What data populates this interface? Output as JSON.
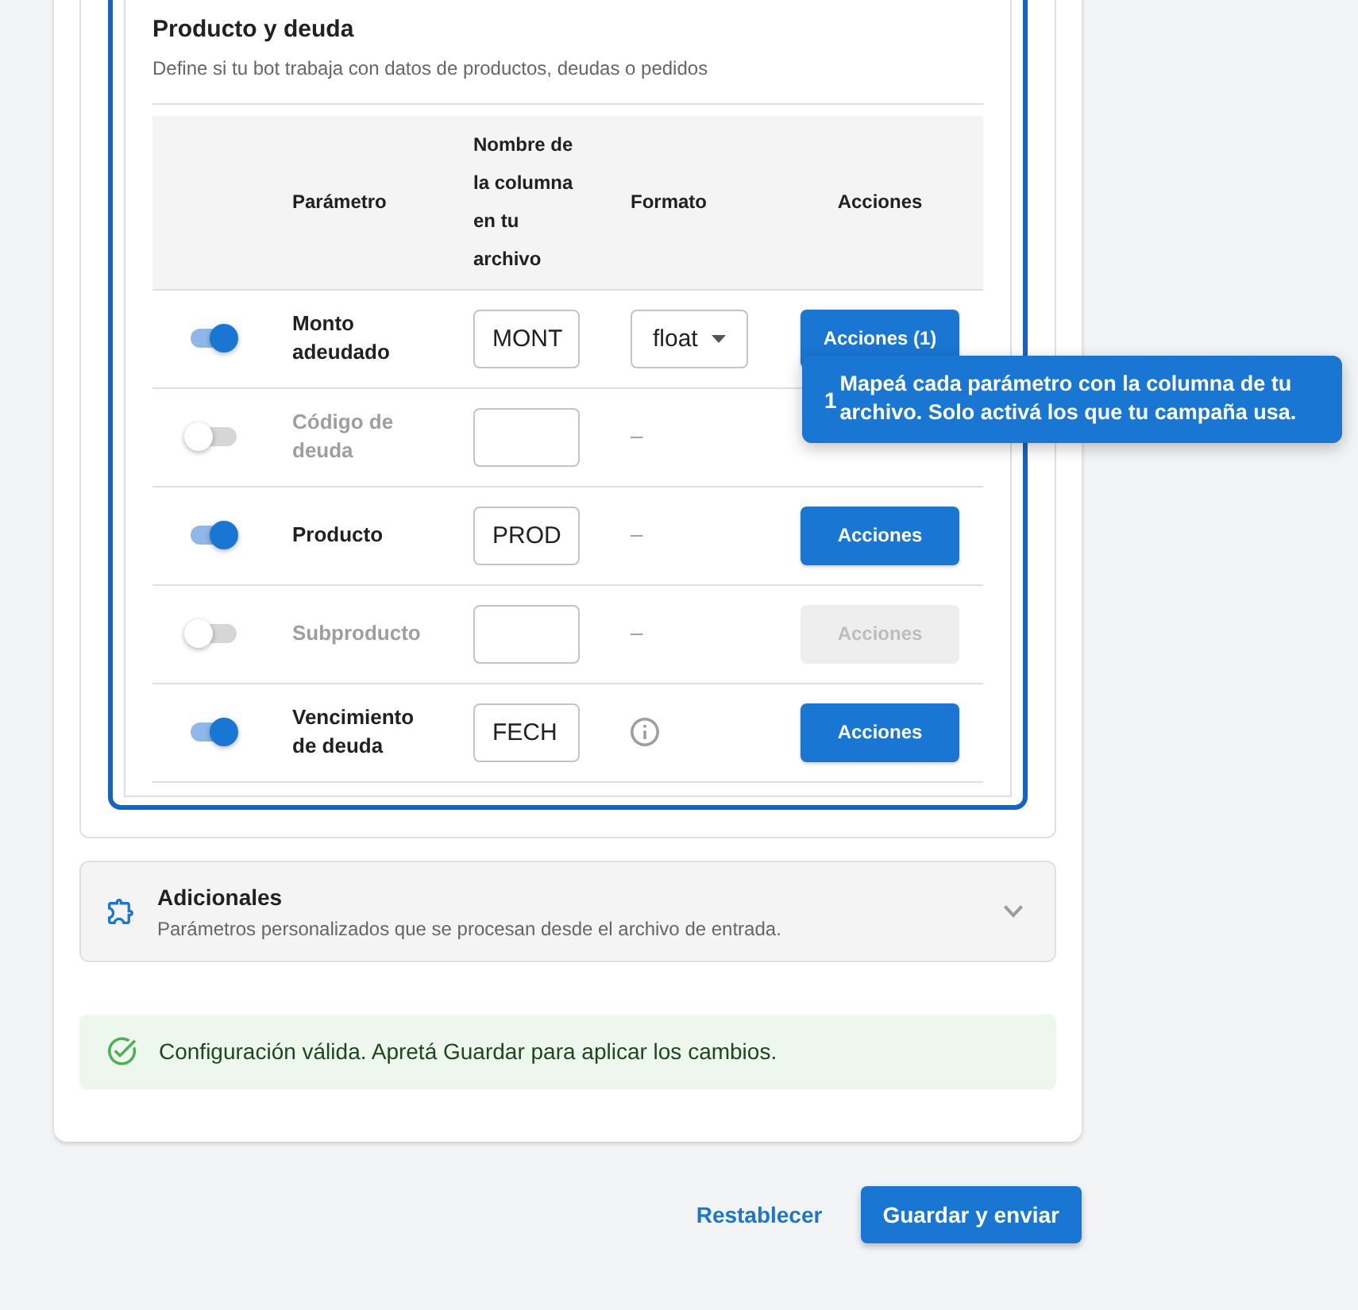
{
  "section": {
    "title": "Producto y deuda",
    "subtitle": "Define si tu bot trabaja con datos de productos, deudas o pedidos",
    "highlighted": true
  },
  "table": {
    "columns": [
      "Parámetro",
      "Nombre de la columna en tu archivo",
      "Formato",
      "Acciones"
    ],
    "rows": [
      {
        "on": true,
        "parameter": "Monto adeudado",
        "column_name": "MONT",
        "format": {
          "kind": "select",
          "value": "float"
        },
        "action": {
          "label": "Acciones (1)",
          "disabled": false
        }
      },
      {
        "on": false,
        "parameter": "Código de deuda",
        "format": {
          "kind": "text",
          "text": "–"
        }
      },
      {
        "on": true,
        "parameter": "Producto",
        "column_name": "PROD",
        "format": {
          "kind": "text",
          "text": "–"
        },
        "action": {
          "label": "Acciones",
          "disabled": false
        }
      },
      {
        "on": false,
        "parameter": "Subproducto",
        "format": {
          "kind": "text",
          "text": "–"
        },
        "action": {
          "label": "Acciones",
          "disabled": true
        }
      },
      {
        "on": true,
        "parameter": "Vencimiento de deuda",
        "column_name": "FECH",
        "format": {
          "kind": "info"
        },
        "action": {
          "label": "Acciones",
          "disabled": false
        }
      }
    ]
  },
  "tooltip": {
    "step": "1",
    "text": "Mapeá cada parámetro con la columna de tu archivo. Solo activá los que tu campaña usa."
  },
  "additional": {
    "title": "Adicionales",
    "subtitle": "Parámetros personalizados que se procesan desde el archivo de entrada.",
    "expanded": false
  },
  "alert": {
    "kind": "success",
    "text": "Configuración válida. Apretá Guardar para aplicar los cambios."
  },
  "footer": {
    "buttons": [
      {
        "label": "Restablecer",
        "kind": "text"
      },
      {
        "label": "Guardar y enviar",
        "kind": "primary"
      }
    ]
  }
}
